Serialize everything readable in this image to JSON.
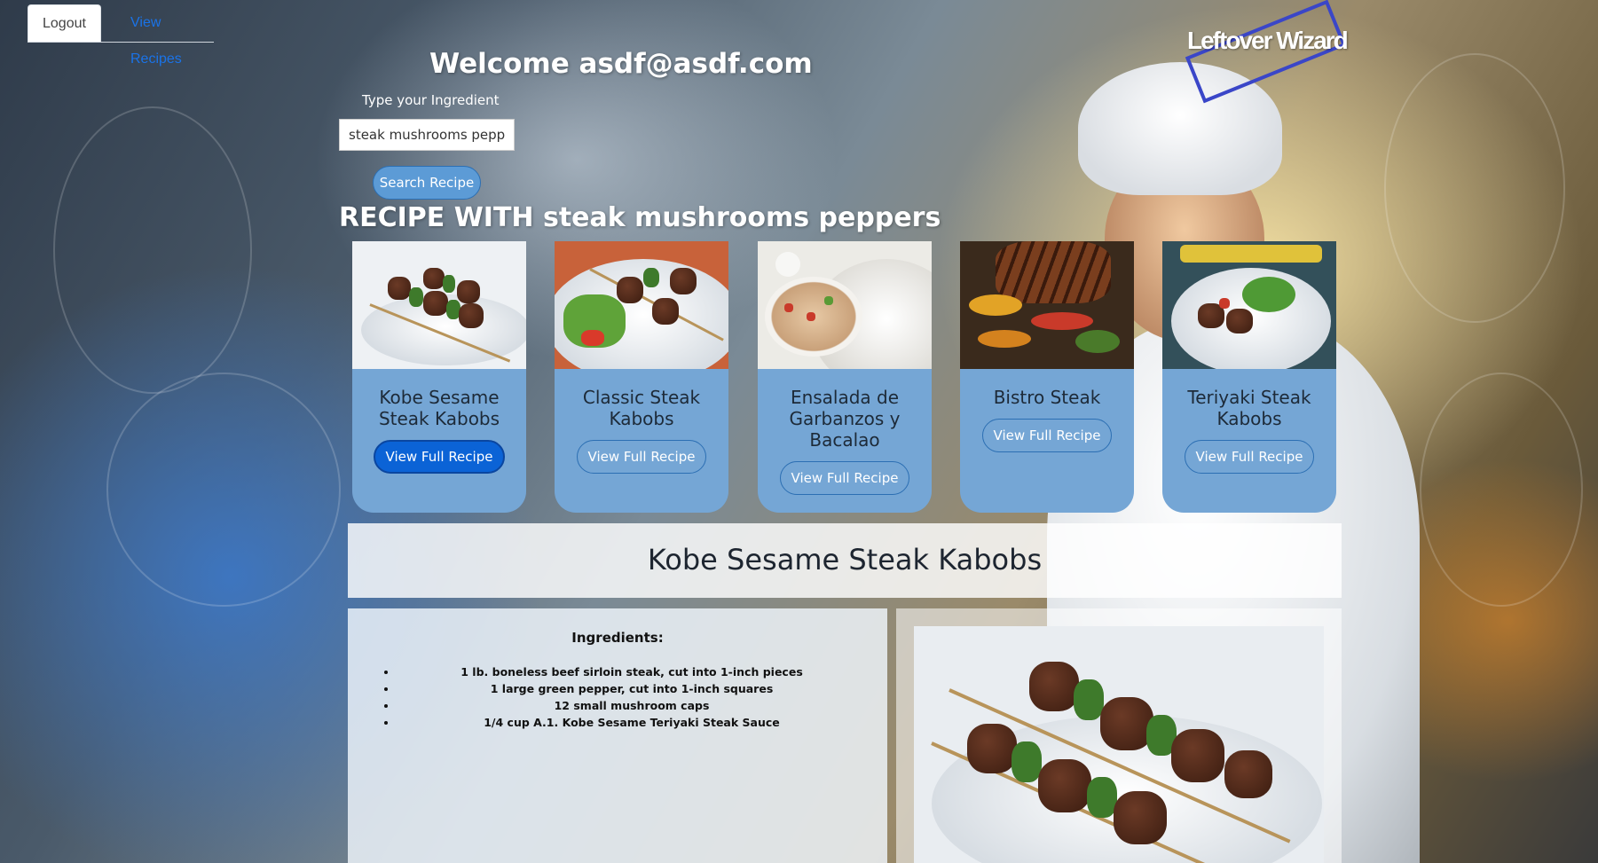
{
  "nav": {
    "logout_label": "Logout",
    "view_recipes_label": "View Recipes"
  },
  "logo": {
    "text": "Leftover Wizard"
  },
  "welcome": {
    "text": "Welcome asdf@asdf.com"
  },
  "search": {
    "label": "Type your Ingredient",
    "value": "steak mushrooms peppe",
    "button_label": "Search Recipe"
  },
  "results": {
    "heading": "RECIPE WITH steak mushrooms peppers",
    "cards": [
      {
        "title": "Kobe Sesame Steak Kabobs",
        "button_label": "View Full Recipe"
      },
      {
        "title": "Classic Steak Kabobs",
        "button_label": "View Full Recipe"
      },
      {
        "title": "Ensalada de Garbanzos y Bacalao",
        "button_label": "View Full Recipe"
      },
      {
        "title": "Bistro Steak",
        "button_label": "View Full Recipe"
      },
      {
        "title": "Teriyaki Steak Kabobs",
        "button_label": "View Full Recipe"
      }
    ]
  },
  "detail": {
    "title": "Kobe Sesame Steak Kabobs",
    "ingredients_heading": "Ingredients:",
    "ingredients": [
      "1 lb. boneless beef sirloin steak, cut into 1-inch pieces",
      "1 large green pepper, cut into 1-inch squares",
      "12 small mushroom caps",
      "1/4 cup A.1. Kobe Sesame Teriyaki Steak Sauce"
    ]
  },
  "colors": {
    "card_bg": "#75a6d5",
    "active_button": "#0b63d6",
    "link": "#1a73e8",
    "logo_frame": "#3a46c8"
  }
}
